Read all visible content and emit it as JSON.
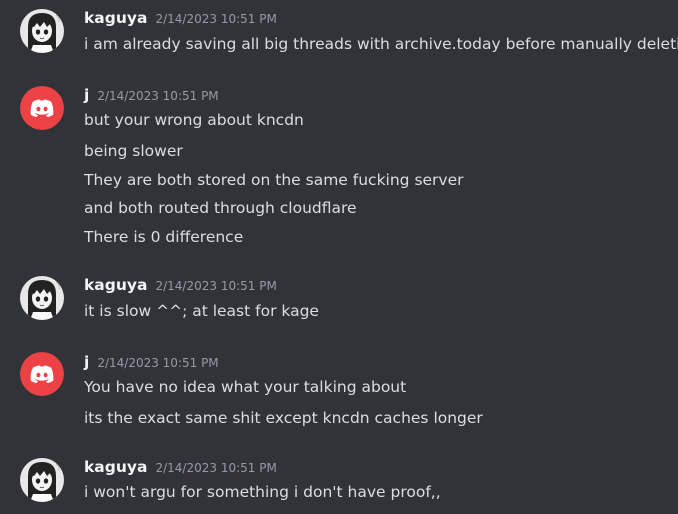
{
  "groups": [
    {
      "username": "kaguya",
      "avatar": "anime-girl-avatar-icon",
      "timestamp": "2/14/2023 10:51 PM",
      "lines": [
        "i am already saving all big threads with archive.today before manually deleting"
      ]
    },
    {
      "username": "j",
      "avatar": "discord-logo-avatar-icon",
      "timestamp": "2/14/2023 10:51 PM",
      "lines": [
        "but your wrong about kncdn",
        "being slower",
        "They are both stored on the same fucking server",
        "and both routed through cloudflare",
        "There is 0 difference"
      ]
    },
    {
      "username": "kaguya",
      "avatar": "anime-girl-avatar-icon",
      "timestamp": "2/14/2023 10:51 PM",
      "lines": [
        "it is slow ^^; at least for kage"
      ]
    },
    {
      "username": "j",
      "avatar": "discord-logo-avatar-icon",
      "timestamp": "2/14/2023 10:51 PM",
      "lines": [
        "You have no idea what your talking about",
        "its the exact same shit except kncdn caches longer"
      ]
    },
    {
      "username": "kaguya",
      "avatar": "anime-girl-avatar-icon",
      "timestamp": "2/14/2023 10:51 PM",
      "lines": [
        "i won't argu for something i don't have proof,,"
      ]
    }
  ],
  "colors": {
    "background": "#313338",
    "username": "#f2f3f5",
    "timestamp": "#949ba4",
    "message": "#dbdee1",
    "discord_blurple": "#ed4245"
  }
}
